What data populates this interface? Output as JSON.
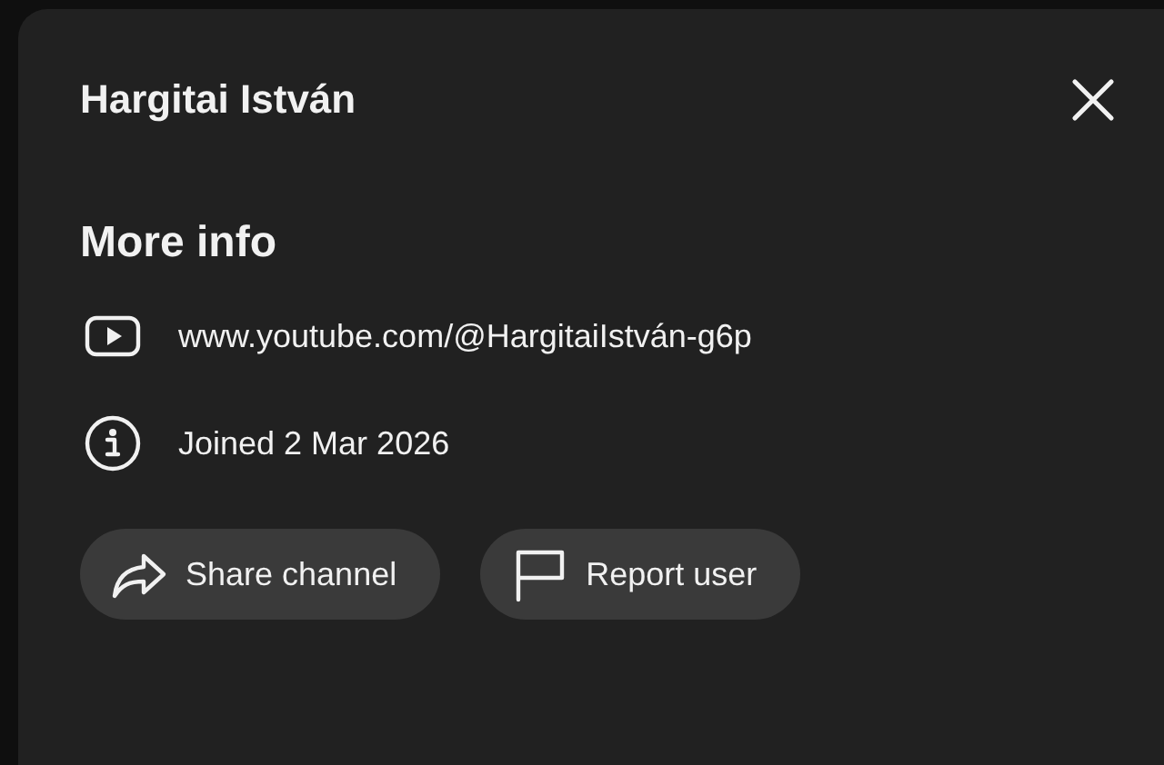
{
  "dialog": {
    "title": "Hargitai István"
  },
  "section": {
    "heading": "More info"
  },
  "details": [
    {
      "kind": "video",
      "text": "www.youtube.com/@HargitaiIstván-g6p"
    },
    {
      "kind": "info",
      "text": "Joined 2 Mar 2026"
    }
  ],
  "buttons": [
    {
      "kind": "share",
      "label": "Share channel"
    },
    {
      "kind": "flag",
      "label": "Report user"
    }
  ]
}
